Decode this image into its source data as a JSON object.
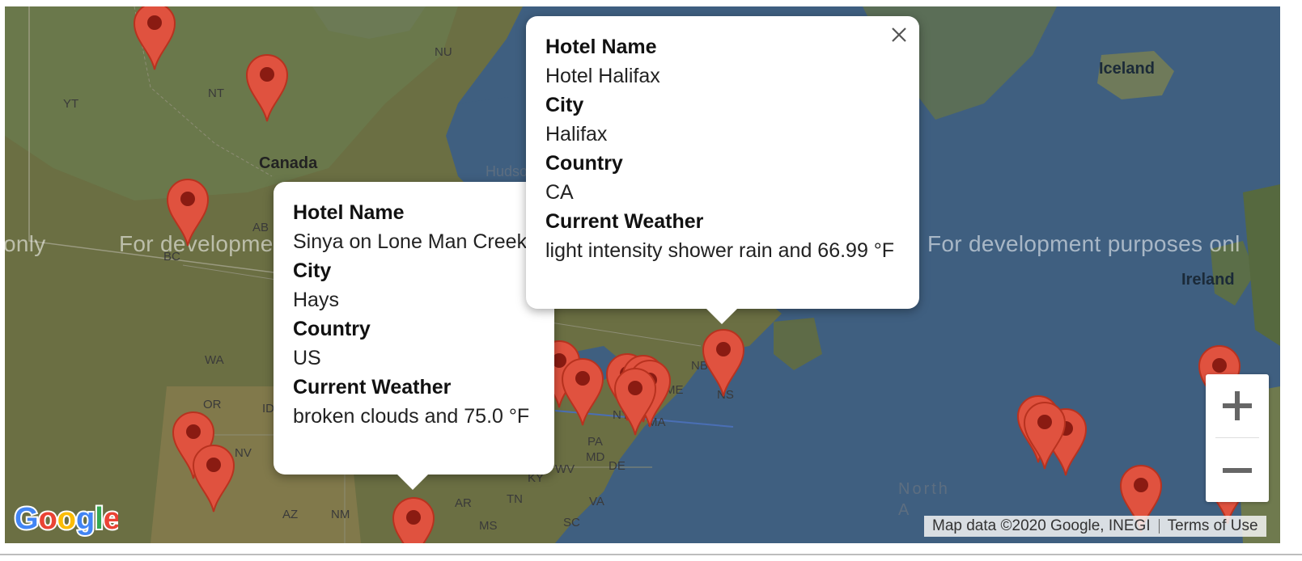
{
  "map": {
    "watermark": "For development purposes only",
    "watermarks": [
      {
        "text": "only"
      },
      {
        "text": "For developme"
      },
      {
        "text": "For development purposes onl"
      }
    ],
    "labels": {
      "nu": "NU",
      "nt": "NT",
      "yt": "YT",
      "canada": "Canada",
      "hudson": "Hudso",
      "ab": "AB",
      "bc": "BC",
      "wa": "WA",
      "or": "OR",
      "id": "ID",
      "nv": "NV",
      "az": "AZ",
      "nm": "NM",
      "ar": "AR",
      "tn": "TN",
      "ky": "KY",
      "wv": "WV",
      "va": "VA",
      "sc": "SC",
      "ms": "MS",
      "pa": "PA",
      "md": "MD",
      "de": "DE",
      "ny": "NY",
      "ma": "MA",
      "nh": "H",
      "me": "ME",
      "nb": "NB",
      "ns": "NS",
      "iceland": "Iceland",
      "ireland": "Ireland",
      "north": "North",
      "atlantic": "A"
    },
    "attribution": {
      "data": "Map data ©2020 Google, INEGI",
      "terms": "Terms of Use"
    },
    "logo_text": "Google",
    "zoom": {
      "in_icon": "plus-icon",
      "out_icon": "minus-icon"
    },
    "marker_color": "#e0523f",
    "marker_dot": "#8a1b12"
  },
  "info_windows": [
    {
      "id": "hays",
      "hotel_label": "Hotel Name",
      "hotel": "Sinya on Lone Man Creek",
      "city_label": "City",
      "city": "Hays",
      "country_label": "Country",
      "country": "US",
      "weather_label": "Current Weather",
      "weather": "broken clouds and 75.0 °F"
    },
    {
      "id": "halifax",
      "hotel_label": "Hotel Name",
      "hotel": "Hotel Halifax",
      "city_label": "City",
      "city": "Halifax",
      "country_label": "Country",
      "country": "CA",
      "weather_label": "Current Weather",
      "weather": "light intensity shower rain and 66.99 °F"
    }
  ]
}
